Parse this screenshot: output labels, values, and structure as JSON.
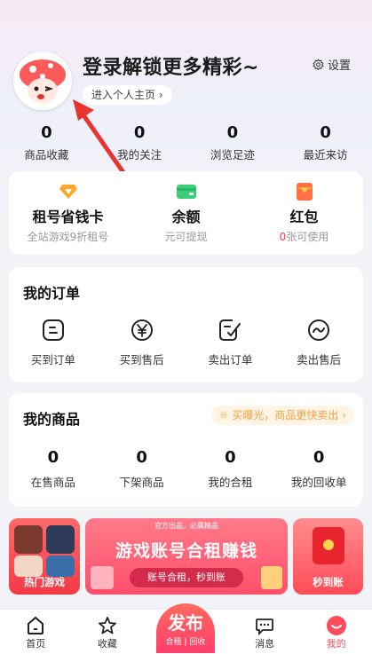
{
  "header": {
    "title": "登录解锁更多精彩~",
    "home_link": "进入个人主页",
    "settings_label": "设置"
  },
  "stats": [
    {
      "value": "0",
      "label": "商品收藏"
    },
    {
      "value": "0",
      "label": "我的关注"
    },
    {
      "value": "0",
      "label": "浏览足迹"
    },
    {
      "value": "0",
      "label": "最近来访"
    }
  ],
  "wallet": {
    "card": {
      "title": "租号省钱卡",
      "subtitle": "全站游戏9折租号",
      "icon": "diamond-icon"
    },
    "balance": {
      "title": "余额",
      "subtitle": "元可提现",
      "icon": "wallet-icon"
    },
    "redpacket": {
      "title": "红包",
      "count": "0",
      "subtitle_suffix": "张可使用",
      "icon": "redpacket-icon"
    }
  },
  "orders": {
    "title": "我的订单",
    "items": [
      {
        "label": "买到订单",
        "icon": "receipt-icon"
      },
      {
        "label": "买到售后",
        "icon": "yen-circle-icon"
      },
      {
        "label": "卖出订单",
        "icon": "sold-order-icon"
      },
      {
        "label": "卖出售后",
        "icon": "after-sale-icon"
      }
    ]
  },
  "goods": {
    "title": "我的商品",
    "promo": "买曝光，商品更快卖出",
    "items": [
      {
        "value": "0",
        "label": "在售商品"
      },
      {
        "value": "0",
        "label": "下架商品"
      },
      {
        "value": "0",
        "label": "我的合租"
      },
      {
        "value": "0",
        "label": "我的回收单"
      }
    ]
  },
  "banners": {
    "hot_games": "热门游戏",
    "main_top": "官方出品，必属精品",
    "main_title": "游戏账号合租赚钱",
    "main_button": "账号合租，秒到账",
    "instant": "秒到账"
  },
  "tabbar": {
    "home": "首页",
    "favorites": "收藏",
    "publish": "发布",
    "publish_sub": "合租 | 回收",
    "messages": "消息",
    "mine": "我的"
  },
  "colors": {
    "accent": "#ff4b5c",
    "promo": "#f5a03c"
  }
}
